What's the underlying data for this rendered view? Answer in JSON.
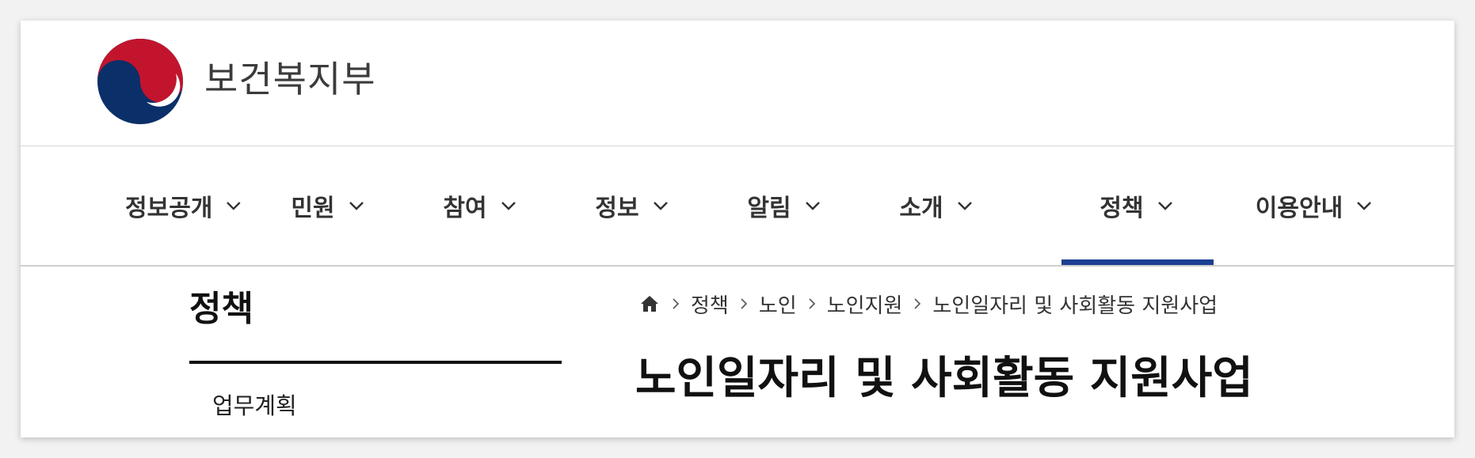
{
  "header": {
    "org_name": "보건복지부"
  },
  "gnb": {
    "items": [
      {
        "label": "정보공개",
        "active": false
      },
      {
        "label": "민원",
        "active": false
      },
      {
        "label": "참여",
        "active": false
      },
      {
        "label": "정보",
        "active": false
      },
      {
        "label": "알림",
        "active": false
      },
      {
        "label": "소개",
        "active": false
      },
      {
        "label": "정책",
        "active": true
      },
      {
        "label": "이용안내",
        "active": false
      }
    ],
    "active_color": "#1b3f93"
  },
  "side_nav": {
    "title": "정책",
    "items": [
      {
        "label": "업무계획"
      }
    ]
  },
  "breadcrumb": {
    "items": [
      "정책",
      "노인",
      "노인지원",
      "노인일자리 및 사회활동 지원사업"
    ]
  },
  "page_title": "노인일자리 및 사회활동 지원사업",
  "icons": {
    "home": "home-icon",
    "separator": "chevron-right-icon",
    "dropdown": "chevron-down-icon"
  }
}
